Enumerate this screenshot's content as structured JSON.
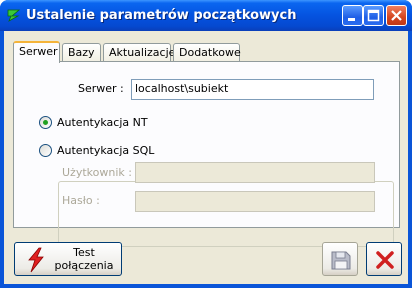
{
  "window": {
    "title": "Ustalenie parametrów początkowych"
  },
  "tabs": [
    {
      "label": "Serwer",
      "active": true
    },
    {
      "label": "Bazy",
      "active": false
    },
    {
      "label": "Aktualizacje",
      "active": false
    },
    {
      "label": "Dodatkowe",
      "active": false
    }
  ],
  "form": {
    "server_label": "Serwer :",
    "server_value": "localhost\\subiekt",
    "auth_nt_label": "Autentykacja NT",
    "auth_nt_selected": true,
    "auth_sql_label": "Autentykacja SQL",
    "auth_sql_selected": false,
    "user_label": "Użytkownik :",
    "user_value": "",
    "password_label": "Hasło :",
    "password_value": ""
  },
  "buttons": {
    "test_line1": "Test",
    "test_line2": "połączenia",
    "save_icon": "floppy-disk-icon",
    "close_icon": "red-x-icon"
  },
  "colors": {
    "titlebar": "#0553e0",
    "client_bg": "#ece9d8",
    "radio_dot": "#21a121",
    "close_x": "#d02020",
    "test_icon": "#e02020"
  }
}
